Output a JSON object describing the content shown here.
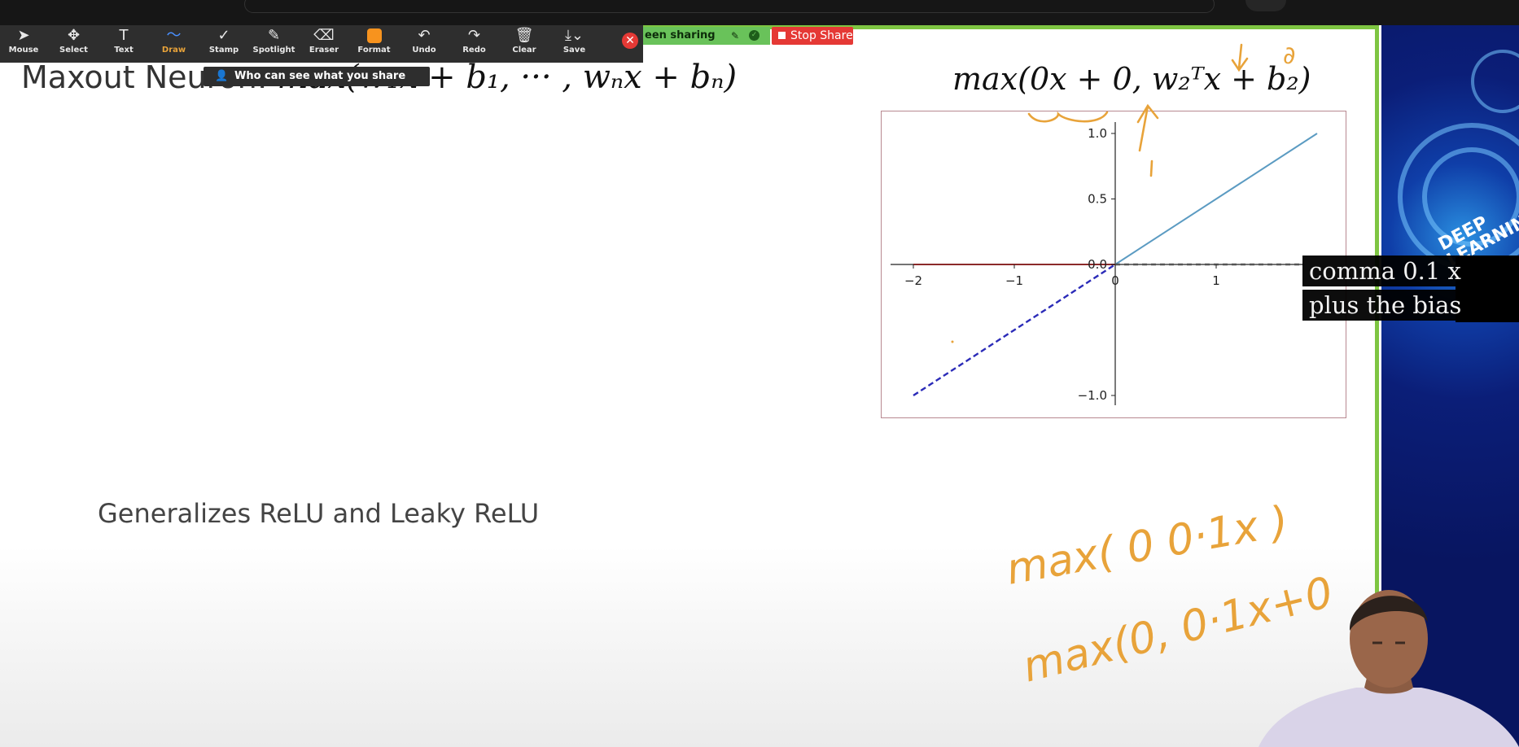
{
  "toolbar": {
    "tools": [
      {
        "label": "Mouse",
        "icon": "cursor-icon"
      },
      {
        "label": "Select",
        "icon": "move-icon"
      },
      {
        "label": "Text",
        "icon": "text-icon"
      },
      {
        "label": "Draw",
        "icon": "draw-icon"
      },
      {
        "label": "Stamp",
        "icon": "check-icon"
      },
      {
        "label": "Spotlight",
        "icon": "wand-icon"
      },
      {
        "label": "Eraser",
        "icon": "eraser-icon"
      },
      {
        "label": "Format",
        "icon": "color-swatch-icon"
      },
      {
        "label": "Undo",
        "icon": "undo-icon"
      },
      {
        "label": "Redo",
        "icon": "redo-icon"
      },
      {
        "label": "Clear",
        "icon": "trash-icon"
      },
      {
        "label": "Save",
        "icon": "save-icon"
      }
    ],
    "active_tool": "Draw",
    "format_color": "#f7931e",
    "tooltip": "Who can see what you share here?"
  },
  "sharing": {
    "status": "een sharing",
    "stop_label": "Stop Share"
  },
  "slide": {
    "title_text": "Maxout Neuron: ",
    "title_math": "max(w₁x + b₁, ··· , wₙx + bₙ)",
    "formula_top": "max(0x + 0, w₂ᵀx + b₂)",
    "subtitle": "Generalizes ReLU and Leaky ReLU",
    "handwritten": [
      "↓ 0",
      "1",
      "max( 0 0·1x )",
      "max(0, 0·1x+0"
    ]
  },
  "chart_data": {
    "type": "line",
    "xlim": [
      -2,
      2
    ],
    "ylim": [
      -1,
      1
    ],
    "x_ticks": [
      "−2",
      "−1",
      "0",
      "1"
    ],
    "y_ticks": [
      "1.0",
      "0.5",
      "0.0",
      "−1.0"
    ],
    "series": [
      {
        "style": "solid",
        "color": "#5b9bc2",
        "x": [
          0,
          2
        ],
        "y": [
          0,
          1
        ]
      },
      {
        "style": "solid",
        "color": "#8b2a2a",
        "x": [
          -2,
          0
        ],
        "y": [
          0,
          0
        ]
      },
      {
        "style": "dashed",
        "color": "#2b2bb8",
        "x": [
          -2,
          0
        ],
        "y": [
          -1,
          0
        ]
      },
      {
        "style": "dashed",
        "color": "#555555",
        "x": [
          0,
          1.85
        ],
        "y": [
          0,
          0
        ]
      }
    ]
  },
  "captions": {
    "line1": "comma 0.1 x",
    "line2": "plus the bias"
  },
  "branding": {
    "panel_text": "DEEP LEARNING"
  }
}
